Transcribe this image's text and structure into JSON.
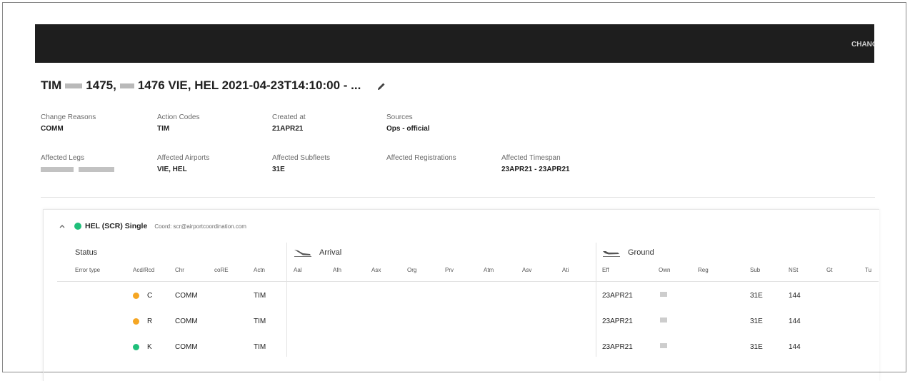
{
  "topbar": {
    "action_label": "CHANGE"
  },
  "title": {
    "prefix": "TIM",
    "flight1": "1475,",
    "flight2": "1476 VIE, HEL 2021-04-23T14:10:00 - ..."
  },
  "meta": [
    {
      "label": "Change Reasons",
      "value": "COMM"
    },
    {
      "label": "Action Codes",
      "value": "TIM"
    },
    {
      "label": "Created at",
      "value": "21APR21"
    },
    {
      "label": "Sources",
      "value": "Ops - official"
    },
    {
      "label": "Affected Legs",
      "value": ""
    },
    {
      "label": "Affected Airports",
      "value": "VIE, HEL"
    },
    {
      "label": "Affected Subfleets",
      "value": "31E"
    },
    {
      "label": "Affected Registrations",
      "value": ""
    },
    {
      "label": "Affected Timespan",
      "value": "23APR21 - 23APR21"
    }
  ],
  "card": {
    "airport": "HEL (SCR) Single",
    "coord": "Coord: scr@airportcoordination.com",
    "status_color": "#1fbf7a"
  },
  "groups": {
    "status": "Status",
    "arrival": "Arrival",
    "ground": "Ground"
  },
  "columns": [
    "Error type",
    "Acd/Rcd",
    "Chr",
    "coRE",
    "Actn",
    "Aal",
    "Afn",
    "Asx",
    "Org",
    "Prv",
    "Atm",
    "Asv",
    "Ati",
    "Eff",
    "Own",
    "Reg",
    "Sub",
    "NSt",
    "Gt",
    "Tu"
  ],
  "rows": [
    {
      "code": "C",
      "color": "#f5a623",
      "chr": "COMM",
      "actn": "TIM",
      "eff": "23APR21",
      "sub": "31E",
      "nst": "144"
    },
    {
      "code": "R",
      "color": "#f5a623",
      "chr": "COMM",
      "actn": "TIM",
      "eff": "23APR21",
      "sub": "31E",
      "nst": "144"
    },
    {
      "code": "K",
      "color": "#1fbf7a",
      "chr": "COMM",
      "actn": "TIM",
      "eff": "23APR21",
      "sub": "31E",
      "nst": "144"
    }
  ]
}
